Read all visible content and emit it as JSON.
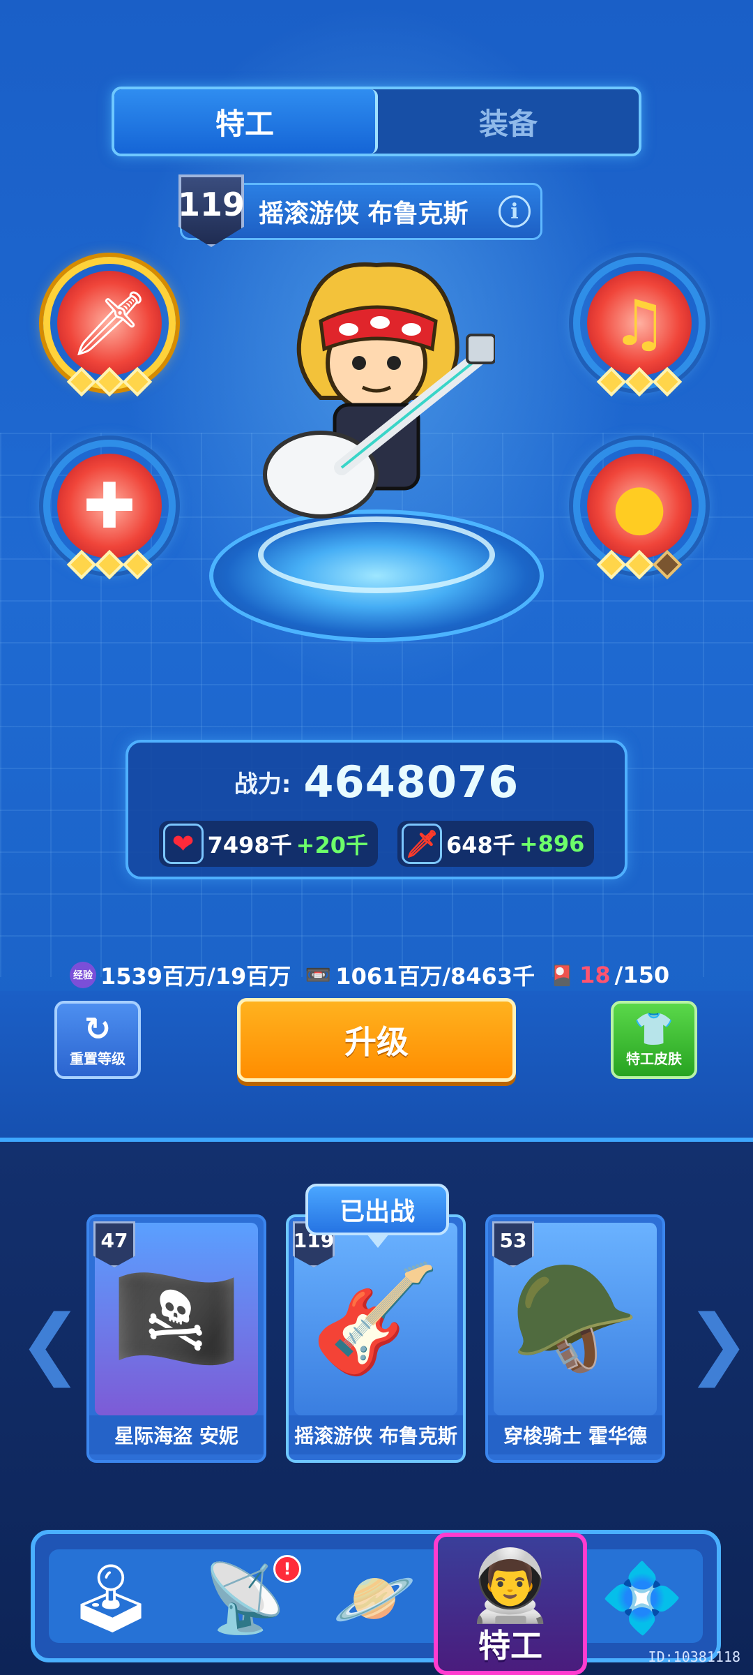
{
  "tabs": [
    {
      "label": "特工",
      "active": true
    },
    {
      "label": "装备",
      "active": false
    }
  ],
  "hero": {
    "level": "119",
    "name": "摇滚游侠 布鲁克斯",
    "info_icon": "info-icon"
  },
  "skills": [
    {
      "icon": "sword-icon",
      "glyph": "🗡",
      "gems_filled": 3,
      "gems_total": 3,
      "rarity": "gold"
    },
    {
      "icon": "plus-diamond-icon",
      "glyph": "✚",
      "gems_filled": 3,
      "gems_total": 3,
      "rarity": "blue"
    },
    {
      "icon": "music-note-icon",
      "glyph": "♫",
      "gems_filled": 3,
      "gems_total": 3,
      "rarity": "blue"
    },
    {
      "icon": "gold-orb-icon",
      "glyph": "●",
      "gems_filled": 2,
      "gems_total": 3,
      "rarity": "blue"
    }
  ],
  "power": {
    "label": "战力:",
    "value": "4648076",
    "hp": {
      "icon": "heart-icon",
      "glyph": "❤",
      "value": "7498千",
      "bonus": "+20千"
    },
    "atk": {
      "icon": "sword-icon",
      "glyph": "🗡",
      "value": "648千",
      "bonus": "+896"
    }
  },
  "resources": {
    "exp": {
      "icon": "exp-icon",
      "glyph": "经验",
      "value": "1539百万/19百万"
    },
    "tape": {
      "icon": "cassette-icon",
      "glyph": "📼",
      "value": "1061百万/8463千"
    },
    "cards": {
      "icon": "card-icon",
      "glyph": "🎴",
      "current": "18",
      "max": "/150"
    }
  },
  "actions": {
    "reset_label": "重置等级",
    "reset_icon": "↻",
    "upgrade_label": "升级",
    "skin_label": "特工皮肤",
    "skin_icon": "👕"
  },
  "roster": {
    "deployed_label": "已出战",
    "cards": [
      {
        "level": "47",
        "name": "星际海盗 安妮",
        "glyph": "🏴‍☠️"
      },
      {
        "level": "119",
        "name": "摇滚游侠 布鲁克斯",
        "glyph": "🎸"
      },
      {
        "level": "53",
        "name": "穿梭骑士 霍华德",
        "glyph": "🪖"
      }
    ],
    "prev_arrow": "❮",
    "next_arrow": "❯"
  },
  "nav": {
    "items": [
      {
        "icon": "arcade-icon",
        "glyph": "🕹"
      },
      {
        "icon": "radar-icon",
        "glyph": "📡",
        "badge": "!"
      },
      {
        "icon": "planet-icon",
        "glyph": "🪐"
      },
      {
        "icon": "agent-helmet-icon",
        "glyph": "👨‍🚀",
        "label": "特工",
        "active": true
      },
      {
        "icon": "gem-frame-icon",
        "glyph": "💠"
      }
    ]
  },
  "footer": {
    "id": "ID:10381118"
  },
  "colors": {
    "accent": "#2f8df0",
    "upgrade": "#ff9d0f",
    "skin": "#3cc232",
    "active_nav": "#ff3ccf",
    "bonus": "#6dff6a"
  }
}
